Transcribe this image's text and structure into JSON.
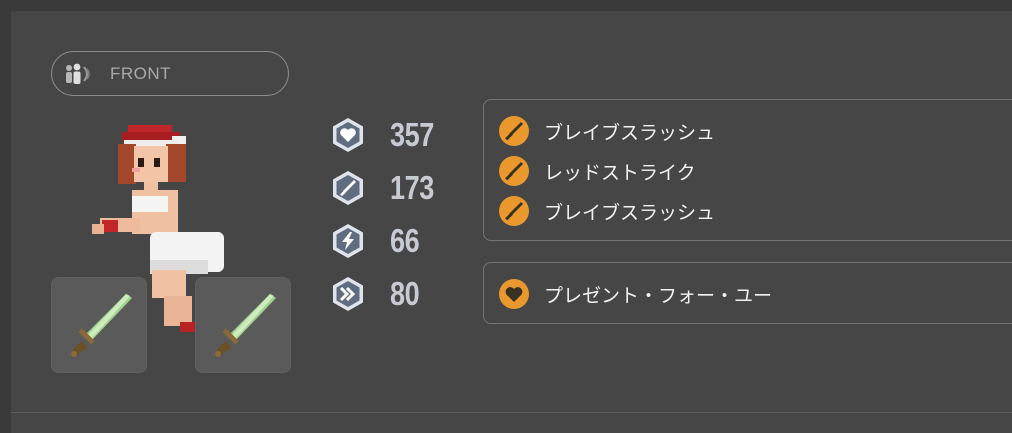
{
  "formation": {
    "label": "FRONT",
    "icon": "party-icon"
  },
  "stats": [
    {
      "icon": "heart-icon",
      "value": "357"
    },
    {
      "icon": "sword-icon",
      "value": "173"
    },
    {
      "icon": "lightning-icon",
      "value": "66"
    },
    {
      "icon": "fast-forward-icon",
      "value": "80"
    }
  ],
  "skills": [
    {
      "icon": "sword-icon",
      "name": "ブレイブスラッシュ"
    },
    {
      "icon": "sword-icon",
      "name": "レッドストライク"
    },
    {
      "icon": "sword-icon",
      "name": "ブレイブスラッシュ"
    }
  ],
  "ability": {
    "icon": "heart-icon",
    "name": "プレゼント・フォー・ユー"
  },
  "equipment": [
    {
      "icon": "green-sword-icon"
    },
    {
      "icon": "green-sword-icon"
    }
  ],
  "colors": {
    "background": "#3a3a3a",
    "panel": "#464646",
    "accent_orange": "#e8982c",
    "stat_text": "#c6cbd3",
    "hex_badge": "#dfe4ec"
  }
}
